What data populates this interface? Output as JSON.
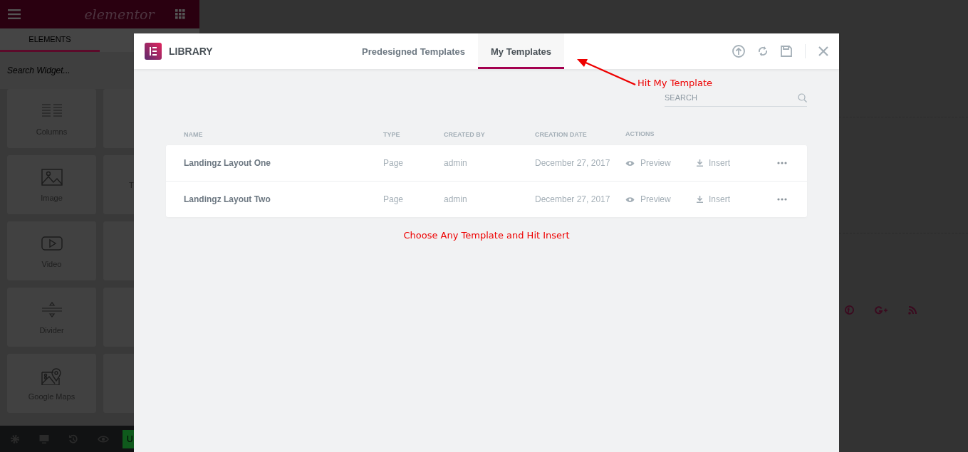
{
  "editor_panel": {
    "logo": "elementor",
    "tabs": [
      {
        "label": "ELEMENTS",
        "selected": true
      },
      {
        "selected": false
      }
    ],
    "search": {
      "placeholder": "Search Widget..."
    },
    "widgets": [
      {
        "label": "Columns",
        "kind": "columns"
      },
      {
        "label": "Image",
        "kind": "image",
        "next_label": "T"
      },
      {
        "label": "Video",
        "kind": "video"
      },
      {
        "label": "Divider",
        "kind": "divider"
      },
      {
        "label": "Google Maps",
        "kind": "map"
      }
    ],
    "footer": {
      "button_label": "U"
    }
  },
  "library": {
    "title": "LIBRARY",
    "tabs": [
      {
        "label": "Predesigned Templates",
        "selected": false
      },
      {
        "label": "My Templates",
        "selected": true
      }
    ],
    "search": {
      "placeholder": "SEARCH"
    },
    "table": {
      "columns": [
        "NAME",
        "TYPE",
        "CREATED BY",
        "CREATION DATE",
        "ACTIONS"
      ],
      "rows": [
        {
          "name": "Landingz Layout One",
          "type": "Page",
          "created_by": "admin",
          "date": "December 27, 2017",
          "preview": "Preview",
          "insert": "Insert"
        },
        {
          "name": "Landingz Layout Two",
          "type": "Page",
          "created_by": "admin",
          "date": "December 27, 2017",
          "preview": "Preview",
          "insert": "Insert"
        }
      ]
    }
  },
  "annotations": [
    {
      "kind": "arrow_note",
      "text": "Hit My Template"
    },
    {
      "kind": "note",
      "text": "Choose Any Template and Hit Insert"
    }
  ]
}
